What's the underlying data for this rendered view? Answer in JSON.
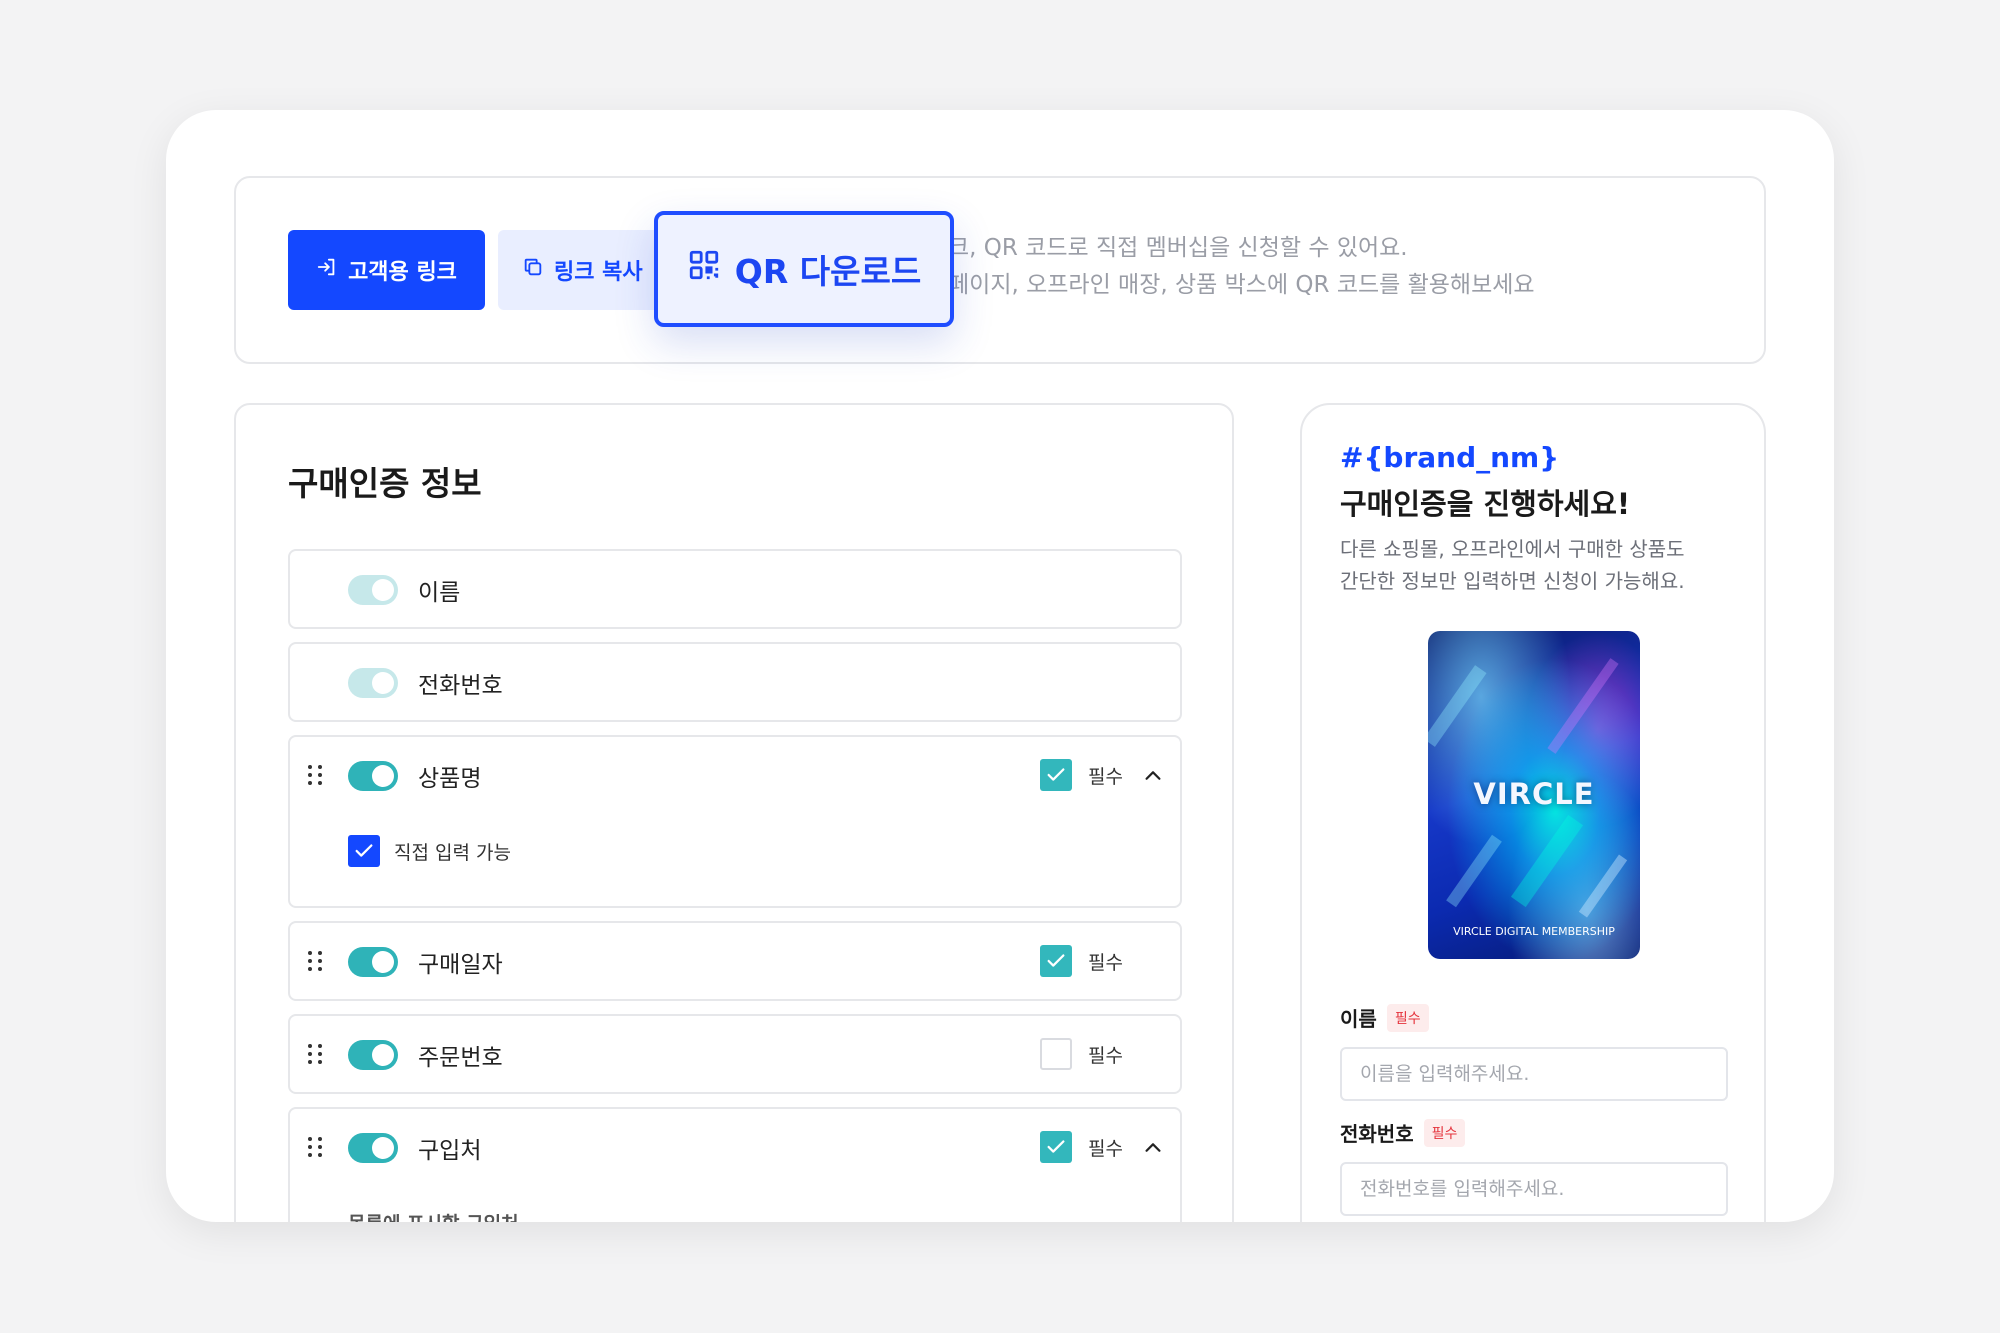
{
  "top": {
    "customer_link_label": "고객용 링크",
    "copy_link_label": "링크 복사",
    "qr_download_label": "QR 다운로드",
    "desc_line1": "크, QR 코드로 직접 멤버십을 신청할 수 있어요.",
    "desc_line2": "페이지, 오프라인 매장, 상품 박스에 QR 코드를 활용해보세요"
  },
  "left": {
    "title": "구매인증 정보",
    "fields": [
      {
        "label": "이름",
        "enabled": true,
        "locked": true
      },
      {
        "label": "전화번호",
        "enabled": true,
        "locked": true
      },
      {
        "label": "상품명",
        "enabled": true,
        "required": true,
        "required_label": "필수",
        "expanded": true,
        "option_label": "직접 입력 가능"
      },
      {
        "label": "구매일자",
        "enabled": true,
        "required": true,
        "required_label": "필수"
      },
      {
        "label": "주문번호",
        "enabled": true,
        "required": false,
        "required_label": "필수"
      },
      {
        "label": "구입처",
        "enabled": true,
        "required": true,
        "required_label": "필수",
        "expanded": true,
        "sub_text": "목록에 표시할 구입처"
      }
    ]
  },
  "right": {
    "brand_var": "#{brand_nm}",
    "heading": "구매인증을 진행하세요!",
    "desc_line1": "다른 쇼핑몰, 오프라인에서 구매한 상품도",
    "desc_line2": "간단한 정보만 입력하면 신청이 가능해요.",
    "card_title": "VIRCLE",
    "card_subtitle": "VIRCLE DIGITAL MEMBERSHIP",
    "name_label": "이름",
    "name_badge": "필수",
    "name_placeholder": "이름을 입력해주세요.",
    "phone_label": "전화번호",
    "phone_badge": "필수",
    "phone_placeholder": "전화번호를 입력해주세요."
  },
  "colors": {
    "primary": "#1448ff",
    "teal": "#2fb3b8",
    "required_red": "#e5343d"
  }
}
